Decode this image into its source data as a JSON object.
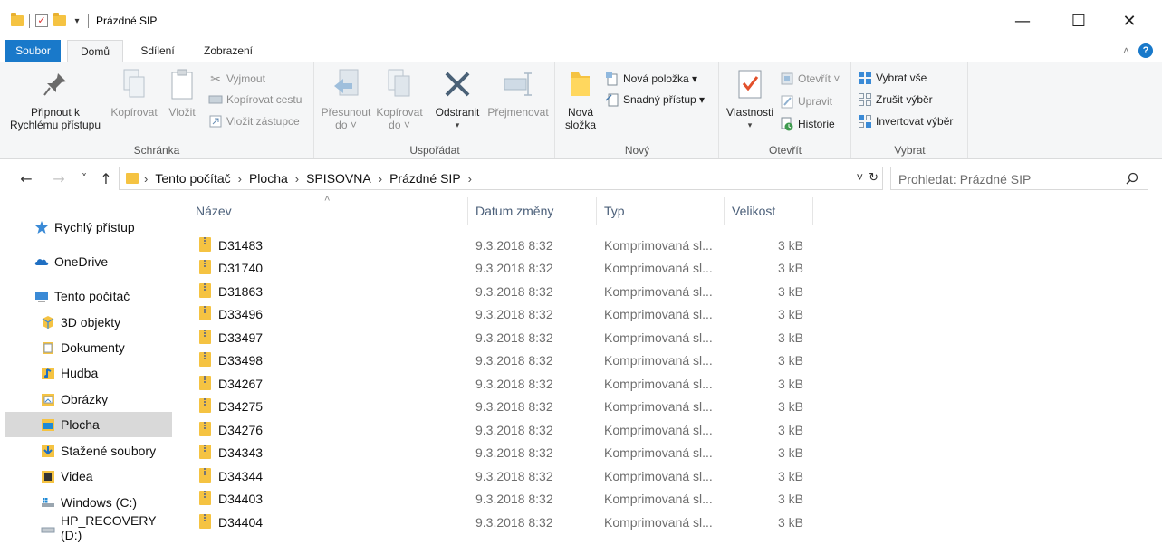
{
  "window": {
    "title": "Prázdné SIP",
    "minimize_glyph": "—",
    "maximize_glyph": "☐",
    "close_glyph": "✕"
  },
  "tabs": [
    {
      "label": "Soubor"
    },
    {
      "label": "Domů"
    },
    {
      "label": "Sdílení"
    },
    {
      "label": "Zobrazení"
    }
  ],
  "ribbon": {
    "clipboard": {
      "label": "Schránka",
      "pin_line1": "Připnout k",
      "pin_line2": "Rychlému přístupu",
      "copy": "Kopírovat",
      "paste": "Vložit",
      "cut": "Vyjmout",
      "copy_path": "Kopírovat cestu",
      "paste_shortcut": "Vložit zástupce"
    },
    "organize": {
      "label": "Uspořádat",
      "move_line1": "Přesunout",
      "move_line2": "do ˅",
      "copyto_line1": "Kopírovat",
      "copyto_line2": "do ˅",
      "delete": "Odstranit",
      "rename": "Přejmenovat"
    },
    "new": {
      "label": "Nový",
      "folder_line1": "Nová",
      "folder_line2": "složka",
      "new_item": "Nová položka ▾",
      "easy_access": "Snadný přístup ▾"
    },
    "open": {
      "label": "Otevřít",
      "properties": "Vlastnosti",
      "open": "Otevřít ˅",
      "edit": "Upravit",
      "history": "Historie"
    },
    "select": {
      "label": "Vybrat",
      "select_all": "Vybrat vše",
      "select_none": "Zrušit výběr",
      "invert": "Invertovat výběr"
    }
  },
  "nav": {
    "back": "←",
    "forward": "→",
    "recent": "˅",
    "up": "↑",
    "breadcrumb": [
      "Tento počítač",
      "Plocha",
      "SPISOVNA",
      "Prázdné SIP"
    ],
    "search_placeholder": "Prohledat: Prázdné SIP"
  },
  "sidebar": {
    "items": [
      {
        "label": "Rychlý přístup",
        "icon": "star-icon"
      },
      {
        "label": "OneDrive",
        "icon": "cloud-icon"
      },
      {
        "label": "Tento počítač",
        "icon": "computer-icon"
      },
      {
        "label": "3D objekty",
        "icon": "cube-icon"
      },
      {
        "label": "Dokumenty",
        "icon": "document-icon"
      },
      {
        "label": "Hudba",
        "icon": "music-icon"
      },
      {
        "label": "Obrázky",
        "icon": "picture-icon"
      },
      {
        "label": "Plocha",
        "icon": "desktop-icon",
        "selected": true
      },
      {
        "label": "Stažené soubory",
        "icon": "download-icon"
      },
      {
        "label": "Videa",
        "icon": "video-icon"
      },
      {
        "label": "Windows (C:)",
        "icon": "drive-icon"
      },
      {
        "label": "HP_RECOVERY (D:)",
        "icon": "drive-icon"
      }
    ]
  },
  "columns": {
    "name": "Název",
    "date": "Datum změny",
    "type": "Typ",
    "size": "Velikost"
  },
  "files": [
    {
      "name": "D31483",
      "date": "9.3.2018 8:32",
      "type": "Komprimovaná sl...",
      "size": "3 kB"
    },
    {
      "name": "D31740",
      "date": "9.3.2018 8:32",
      "type": "Komprimovaná sl...",
      "size": "3 kB"
    },
    {
      "name": "D31863",
      "date": "9.3.2018 8:32",
      "type": "Komprimovaná sl...",
      "size": "3 kB"
    },
    {
      "name": "D33496",
      "date": "9.3.2018 8:32",
      "type": "Komprimovaná sl...",
      "size": "3 kB"
    },
    {
      "name": "D33497",
      "date": "9.3.2018 8:32",
      "type": "Komprimovaná sl...",
      "size": "3 kB"
    },
    {
      "name": "D33498",
      "date": "9.3.2018 8:32",
      "type": "Komprimovaná sl...",
      "size": "3 kB"
    },
    {
      "name": "D34267",
      "date": "9.3.2018 8:32",
      "type": "Komprimovaná sl...",
      "size": "3 kB"
    },
    {
      "name": "D34275",
      "date": "9.3.2018 8:32",
      "type": "Komprimovaná sl...",
      "size": "3 kB"
    },
    {
      "name": "D34276",
      "date": "9.3.2018 8:32",
      "type": "Komprimovaná sl...",
      "size": "3 kB"
    },
    {
      "name": "D34343",
      "date": "9.3.2018 8:32",
      "type": "Komprimovaná sl...",
      "size": "3 kB"
    },
    {
      "name": "D34344",
      "date": "9.3.2018 8:32",
      "type": "Komprimovaná sl...",
      "size": "3 kB"
    },
    {
      "name": "D34403",
      "date": "9.3.2018 8:32",
      "type": "Komprimovaná sl...",
      "size": "3 kB"
    },
    {
      "name": "D34404",
      "date": "9.3.2018 8:32",
      "type": "Komprimovaná sl...",
      "size": "3 kB"
    }
  ],
  "colors": {
    "accent": "#1979ca",
    "folder": "#f5c342",
    "selection": "#d9d9d9"
  }
}
